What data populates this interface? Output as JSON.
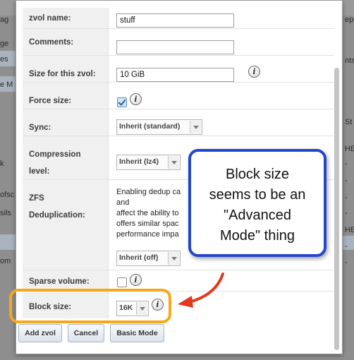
{
  "background": {
    "left_fragments": [
      "ag",
      "ge",
      "es",
      "e M",
      "k",
      "ofsc",
      "sils",
      "om"
    ],
    "right_fragments": [
      "epo",
      "nts",
      "St",
      "HE",
      "-",
      "-",
      "-",
      "-",
      "HE",
      "-",
      "-"
    ]
  },
  "form": {
    "zvol_name": {
      "label": "zvol name:",
      "value": "stuff"
    },
    "comments": {
      "label": "Comments:",
      "value": ""
    },
    "size": {
      "label": "Size for this zvol:",
      "value": "10 GiB"
    },
    "force_size": {
      "label": "Force size:",
      "checked": true
    },
    "sync": {
      "label": "Sync:",
      "selected": "Inherit (standard)"
    },
    "compression": {
      "label": "Compression\nlevel:",
      "selected": "Inherit (lz4)"
    },
    "dedup": {
      "label": "ZFS\nDeduplication:",
      "help_lines": [
        "Enabling dedup ca",
        "and",
        "affect the ability to",
        "offers similar spac",
        "performance impa"
      ],
      "selected": "Inherit (off)"
    },
    "sparse": {
      "label": "Sparse volume:",
      "checked": false
    },
    "block_size": {
      "label": "Block size:",
      "selected": "16K"
    }
  },
  "buttons": {
    "add_zvol": "Add zvol",
    "cancel": "Cancel",
    "basic_mode": "Basic Mode"
  },
  "annotation": {
    "text": "Block size\nseems to be an\n\"Advanced\nMode\" thing",
    "callout_border_color": "#2347cc",
    "highlight_color": "#f5a81c",
    "arrow_color": "#e2391e"
  },
  "icons": [
    "info-icon",
    "checkbox-icon",
    "chevron-down-icon"
  ]
}
